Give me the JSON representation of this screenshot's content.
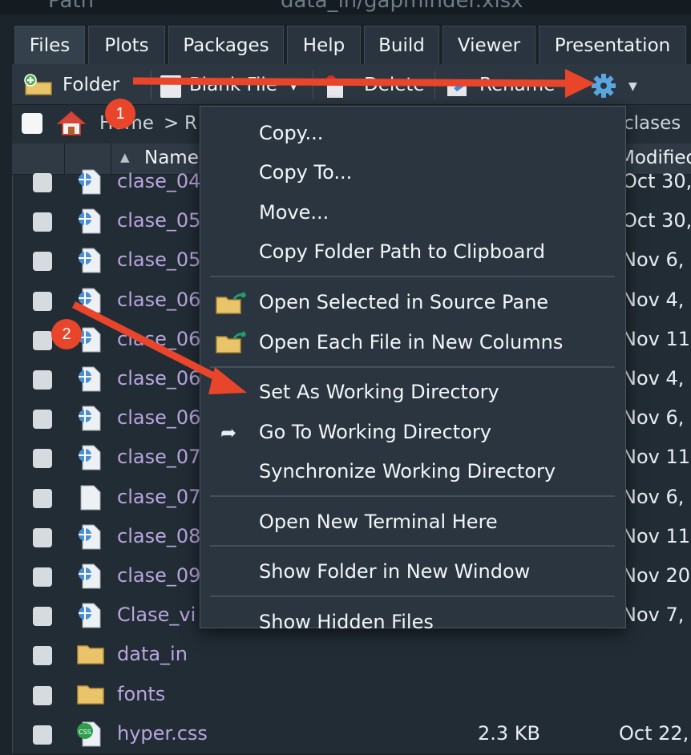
{
  "top_strip": {
    "left_text": "Path",
    "right_text": "data_in/gapminder.xlsx"
  },
  "tabs": [
    "Files",
    "Plots",
    "Packages",
    "Help",
    "Build",
    "Viewer",
    "Presentation"
  ],
  "toolbar": {
    "new_folder": "Folder",
    "new_file": "Blank File",
    "delete": "Delete",
    "rename": "Rename"
  },
  "breadcrumb": {
    "home": "Home",
    "separator": ">",
    "partial": "R",
    "current": "clases"
  },
  "columns": {
    "name": "Name",
    "modified": "Modified"
  },
  "files": [
    {
      "name": "clase_04",
      "modified": "Oct 30,",
      "icon": "qmd-icon"
    },
    {
      "name": "clase_05",
      "modified": "Oct 30,",
      "icon": "qmd-icon"
    },
    {
      "name": "clase_05",
      "modified": "Nov 6,",
      "icon": "qmd-icon"
    },
    {
      "name": "clase_06",
      "modified": "Nov 4,",
      "icon": "qmd-icon"
    },
    {
      "name": "clase_06",
      "modified": "Nov 11",
      "icon": "qmd-icon"
    },
    {
      "name": "clase_06",
      "modified": "Nov 4,",
      "icon": "qmd-icon"
    },
    {
      "name": "clase_06",
      "modified": "Nov 6,",
      "icon": "qmd-icon"
    },
    {
      "name": "clase_07",
      "modified": "Nov 11",
      "icon": "qmd-icon"
    },
    {
      "name": "clase_07",
      "modified": "Nov 6,",
      "icon": "blank-file-icon"
    },
    {
      "name": "clase_08",
      "modified": "Nov 11",
      "icon": "qmd-icon"
    },
    {
      "name": "clase_09",
      "modified": "Nov 20",
      "icon": "qmd-icon"
    },
    {
      "name": "Clase_vi",
      "modified": "Nov 7,",
      "icon": "qmd-icon"
    },
    {
      "name": "data_in",
      "modified": "",
      "icon": "folder-icon"
    },
    {
      "name": "fonts",
      "modified": "",
      "icon": "folder-icon"
    },
    {
      "name": "hyper.css",
      "size": "2.3 KB",
      "modified": "Oct 22,",
      "icon": "css-icon"
    }
  ],
  "menu": {
    "copy": "Copy...",
    "copy_to": "Copy To...",
    "move": "Move...",
    "copy_path": "Copy Folder Path to Clipboard",
    "open_selected": "Open Selected in Source Pane",
    "open_each": "Open Each File in New Columns",
    "set_wd": "Set As Working Directory",
    "go_wd": "Go To Working Directory",
    "sync_wd": "Synchronize Working Directory",
    "terminal": "Open New Terminal Here",
    "new_window": "Show Folder in New Window",
    "hidden": "Show Hidden Files"
  },
  "annotations": {
    "step1": "1",
    "step2": "2",
    "arrow_color": "#e8452b"
  }
}
